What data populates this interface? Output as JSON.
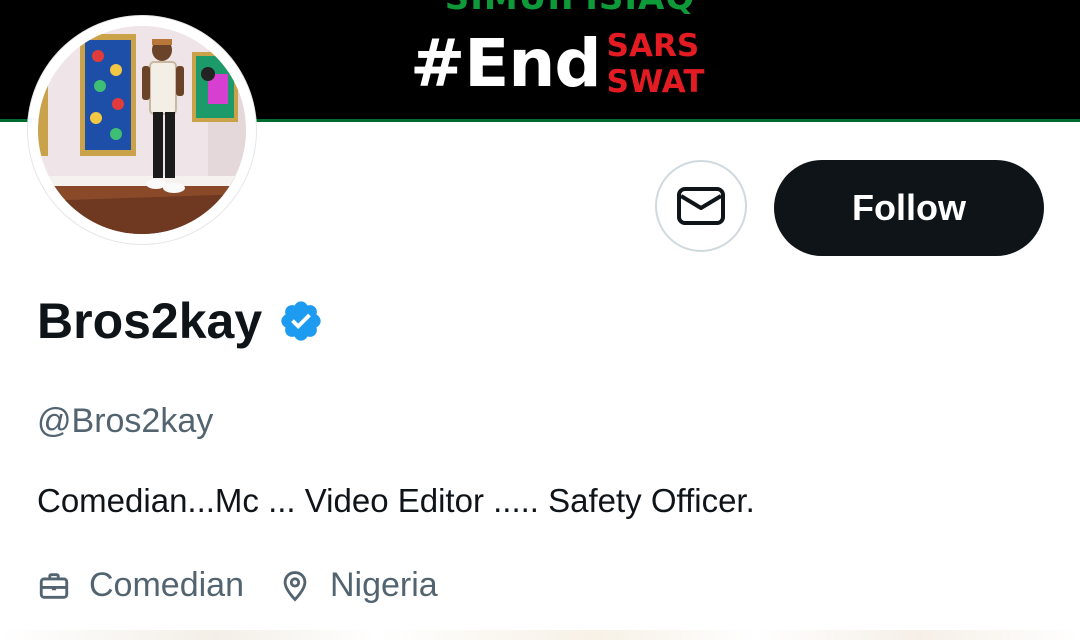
{
  "banner": {
    "top_text": "SIMUIFISIAQ",
    "hashtag": "#End",
    "hashtag_stack": [
      "SARS",
      "SWAT"
    ]
  },
  "profile": {
    "display_name": "Bros2kay",
    "verified": true,
    "handle": "@Bros2kay",
    "bio": "Comedian...Mc ... Video Editor ..... Safety Officer.",
    "profession": "Comedian",
    "location": "Nigeria"
  },
  "actions": {
    "follow_label": "Follow",
    "message_icon": "mail-icon"
  },
  "colors": {
    "banner_bg": "#000000",
    "accent_green": "#0f9a3a",
    "accent_red": "#e31b23",
    "follow_bg": "#0f1419",
    "verified_blue": "#1d9bf0",
    "secondary_text": "#536471"
  }
}
